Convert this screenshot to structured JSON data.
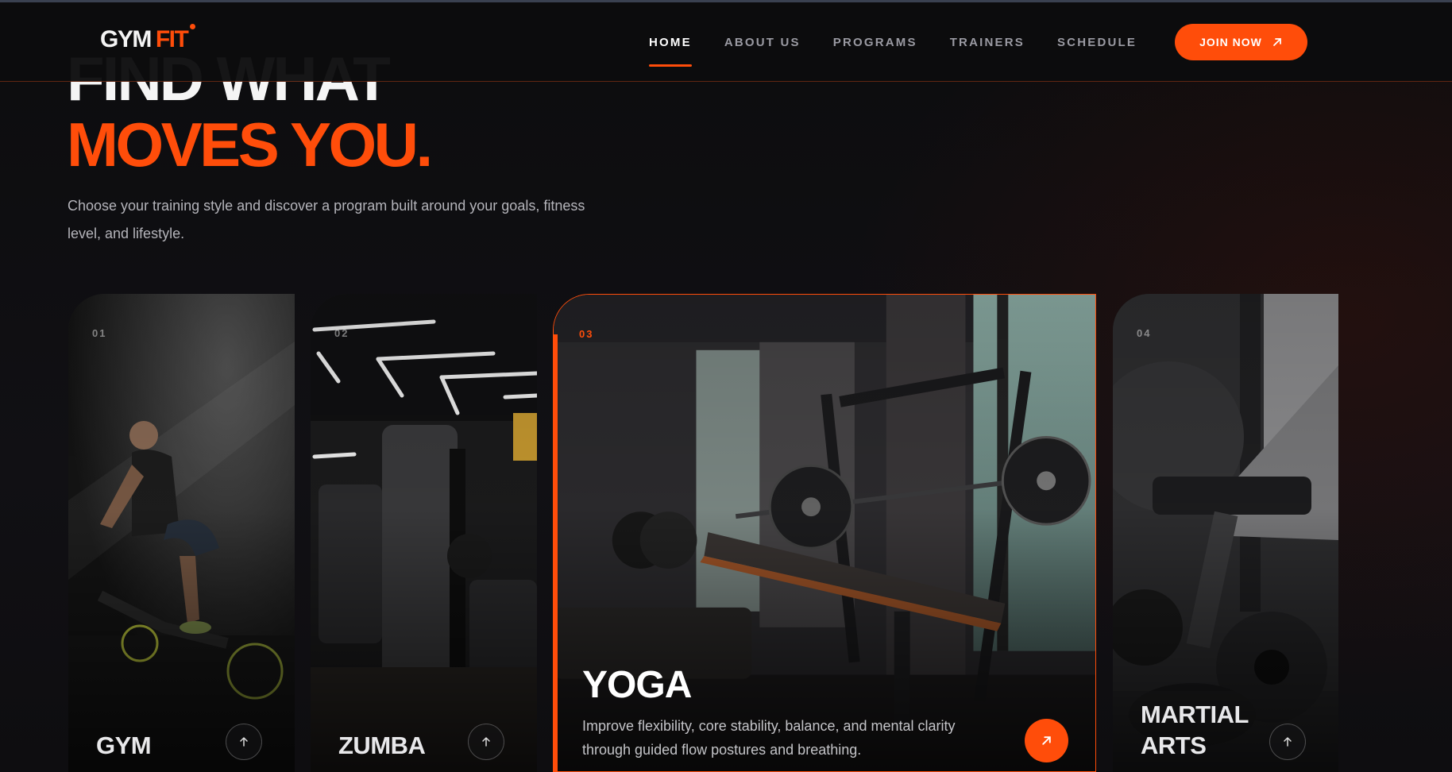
{
  "brand": {
    "logo_word1": "GYM",
    "logo_word2": "FIT",
    "accent_color": "#ff4d0a"
  },
  "nav": {
    "links": [
      {
        "label": "HOME",
        "active": true
      },
      {
        "label": "ABOUT US",
        "active": false
      },
      {
        "label": "PROGRAMS",
        "active": false
      },
      {
        "label": "TRAINERS",
        "active": false
      },
      {
        "label": "SCHEDULE",
        "active": false
      }
    ],
    "cta_label": "JOIN NOW",
    "cta_icon": "arrow-up-right-icon"
  },
  "hero": {
    "line1": "FIND WHAT",
    "line2": "MOVES YOU.",
    "subtitle": "Choose your training style and discover a program built around your goals, fitness level, and lifestyle."
  },
  "programs": [
    {
      "number": "01",
      "title": "GYM",
      "icon": "arrow-up-icon"
    },
    {
      "number": "02",
      "title": "ZUMBA",
      "icon": "arrow-up-icon"
    },
    {
      "number": "03",
      "title": "YOGA",
      "description": "Improve flexibility, core stability, balance, and mental clarity through guided flow postures and breathing.",
      "icon": "arrow-up-right-icon",
      "active": true
    },
    {
      "number": "04",
      "title": "MARTIAL ARTS",
      "icon": "arrow-up-icon"
    }
  ]
}
